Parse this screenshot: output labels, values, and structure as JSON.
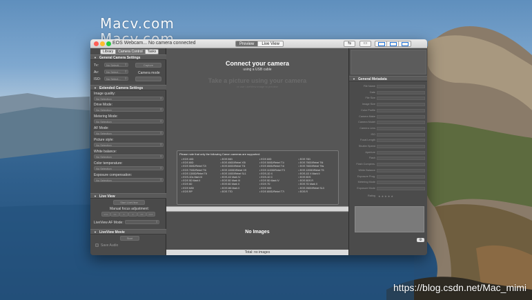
{
  "watermark": {
    "line1": "Macv.com",
    "line2": "Macv.com"
  },
  "url_watermark": "https://blog.csdn.net/Mac_mimi",
  "window": {
    "title": "EOS Webcam... No camera connected"
  },
  "toolbar": {
    "preview_label": "Preview",
    "liveview_label": "Live View"
  },
  "sidebar": {
    "tabs": [
      "Library",
      "Camera Control",
      "Tasks"
    ],
    "active_tab": "Camera Control",
    "general_settings": {
      "title": "General Camera Settings",
      "tv_label": "Tv:",
      "av_label": "Av:",
      "iso_label": "ISO:",
      "tv_value": "No Selecti...",
      "av_value": "No Select...",
      "iso_value": "No Select...",
      "capture_button": "Capture",
      "camera_mode_label": "Camera mode"
    },
    "extended_settings": {
      "title": "Extended Camera Settings",
      "image_quality_label": "Image quality:",
      "image_quality_value": "No Selection",
      "drive_mode_label": "Drive Mode:",
      "drive_mode_value": "No Selection",
      "metering_mode_label": "Metering Mode:",
      "metering_mode_value": "No Selection",
      "af_mode_label": "AF Mode:",
      "af_mode_value": "No Selection",
      "picture_style_label": "Picture style:",
      "picture_style_value": "No Selection",
      "white_balance_label": "White balance:",
      "white_balance_value": "No Selection",
      "color_temperature_label": "Color temperature:",
      "color_temperature_value": "No Selection",
      "exposure_comp_label": "Exposure compensation:",
      "exposure_comp_value": "No Selection"
    },
    "live_view": {
      "title": "Live View",
      "start_button": "Start LiveView",
      "manual_focus_label": "Manual focus adjustment:",
      "focus_buttons": [
        "<<<",
        "<<",
        "<",
        ">",
        ">>",
        ">>>"
      ],
      "af_mode_label": "LiveView AF Mode:"
    },
    "live_view_movie": {
      "title": "LiveView Movie",
      "start_button": "Start",
      "save_audio_label": "Save Audio"
    }
  },
  "preview": {
    "connect_title": "Connect your camera",
    "connect_subtitle": "using a USB cable",
    "take_title": "Take a picture using your camera",
    "take_subtitle": "or use LiveView image to preview",
    "note": "Please note that only the following Canon cameras are supported:",
    "cameras": [
      "EOS 40D",
      "EOS 50D",
      "EOS 60D",
      "EOS 70D",
      "EOS 80D",
      "EOS 450D/Rebel XSi",
      "EOS 500D/Rebel T1i",
      "EOS 750D/Rebel T6i",
      "EOS 550D/Rebel T2i",
      "EOS 600D/Rebel T3i",
      "EOS 650D/Rebel T4i",
      "EOS 760D/Rebel T6s",
      "EOS 700D/Rebel T5i",
      "EOS 1000D/Rebel XS",
      "EOS 1100D/Rebel T3",
      "EOS 1200D/Rebel T5",
      "EOS 1300D/Rebel T6",
      "EOS 100D/Rebel SL1",
      "EOS-1D X",
      "EOS-1D X Mark II",
      "EOS-1Ds Mark III",
      "EOS-1D Mark IV",
      "EOS-1D C",
      "EOS 5DS",
      "EOS 5D Mark II",
      "EOS 5D Mark III",
      "EOS 5D Mark IV",
      "EOS 5DS R",
      "EOS 6D",
      "EOS 6D Mark II",
      "EOS 7D",
      "EOS 7D Mark II",
      "EOS M50",
      "EOS M6 Mark II",
      "EOS 90D",
      "EOS 250D/Rebel SL3",
      "EOS RP",
      "EOS 77D",
      "EOS 800D/Rebel T7i",
      "EOS R"
    ]
  },
  "browser": {
    "empty_label": "No Images"
  },
  "status": {
    "text": "Total: no images"
  },
  "metadata": {
    "title": "General Metadata",
    "fields": [
      "File Name",
      "Date",
      "File Size",
      "Image Size",
      "Color Profile",
      "Camera Make",
      "Camera Model",
      "Camera Lens",
      "ISO",
      "Focal Length",
      "Shutter Speed",
      "Aperture",
      "Flash",
      "Flash Compens.",
      "White Balance",
      "Exposure Prog.",
      "Metering Mode",
      "Exposure Mode"
    ],
    "rating_label": "Rating",
    "rating_stars": "★★★★★",
    "rating_value": 0
  },
  "colors": {
    "window_bg": "#3d3d3d",
    "panel_bg": "#4a4a4a",
    "accent_blue": "#1b6fd6"
  }
}
